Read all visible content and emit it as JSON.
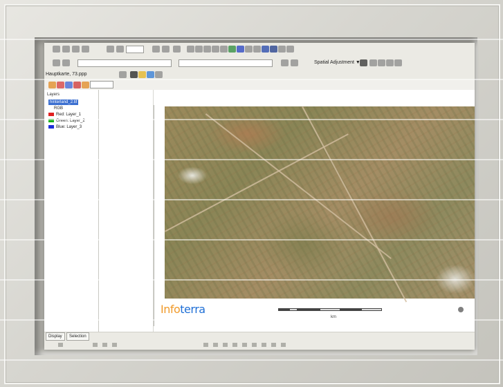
{
  "toolbars": {
    "layer_combo": "Hauptkarte, 73.ppp",
    "spatial_adjustment": "Spatial Adjustment ▼"
  },
  "toc": {
    "title": "Layers",
    "items": [
      {
        "label": "hinterland_2.tif",
        "color": "#3b6fd0",
        "selected": true
      },
      {
        "label": "RGB",
        "color": "",
        "selected": false
      },
      {
        "label": "Red: Layer_1",
        "color": "#e02020",
        "selected": false
      },
      {
        "label": "Green: Layer_2",
        "color": "#19b219",
        "selected": false
      },
      {
        "label": "Blue: Layer_3",
        "color": "#1d2fd9",
        "selected": false
      }
    ]
  },
  "layout": {
    "logo_part1": "Info",
    "logo_part2": "terra",
    "scale_label": "km"
  },
  "status": {
    "tabs": [
      "Display",
      "Selection"
    ]
  },
  "colors": {
    "accent": "#3b6fd0",
    "logo_orange": "#f09a2a",
    "logo_blue": "#1f6fd6",
    "frame": "#d6d5cf"
  }
}
